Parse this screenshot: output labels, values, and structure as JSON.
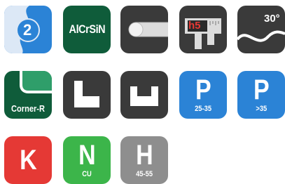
{
  "colors": {
    "blue": "#2b83d6",
    "dark": "#3a3a3a",
    "green_dark": "#0f5c3a",
    "green_light": "#2f9e6a",
    "red": "#e53935",
    "green": "#3cb54a",
    "gray": "#8e8e8e",
    "h5_red": "#e53935"
  },
  "icons": [
    {
      "name": "coating-2-icon",
      "text": "2"
    },
    {
      "name": "alcrsin-coating-icon",
      "text": "AlCrSiN"
    },
    {
      "name": "round-bar-icon"
    },
    {
      "name": "caliper-tolerance-icon",
      "text": "h5"
    },
    {
      "name": "helix-angle-icon",
      "text": "30°"
    },
    {
      "name": "corner-radius-icon",
      "text": "Corner-R"
    },
    {
      "name": "shoulder-profile-icon"
    },
    {
      "name": "slot-profile-icon"
    },
    {
      "name": "material-p-25-35-icon",
      "letter": "P",
      "range": "25-35"
    },
    {
      "name": "material-p-over-35-icon",
      "letter": "P",
      "range": ">35"
    },
    {
      "name": "material-k-icon",
      "letter": "K"
    },
    {
      "name": "material-n-cu-icon",
      "letter": "N",
      "range": "CU"
    },
    {
      "name": "material-h-45-55-icon",
      "letter": "H",
      "range": "45-55"
    }
  ]
}
